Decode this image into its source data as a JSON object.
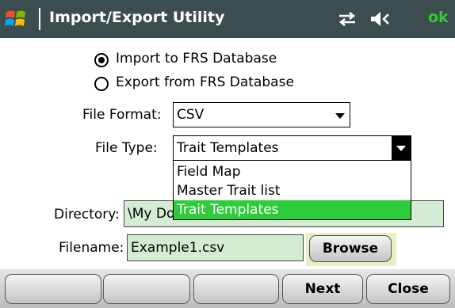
{
  "titlebar": {
    "title": "Import/Export Utility",
    "ok_label": "ok",
    "icons": [
      "windows-start-icon",
      "connectivity-icon",
      "volume-icon"
    ]
  },
  "mode": {
    "import_label": "Import to FRS Database",
    "export_label": "Export from FRS Database",
    "selected": "import"
  },
  "file_format": {
    "label": "File Format:",
    "value": "CSV"
  },
  "file_type": {
    "label": "File Type:",
    "value": "Trait Templates",
    "options": [
      "Field Map",
      "Master Trait list",
      "Trait Templates"
    ],
    "highlighted": "Trait Templates"
  },
  "directory": {
    "label": "Directory:",
    "value_visible": "\\My Do"
  },
  "filename": {
    "label": "Filename:",
    "value": "Example1.csv",
    "browse_label": "Browse"
  },
  "softkeys": [
    "",
    "",
    "",
    "Next",
    "Close"
  ],
  "colors": {
    "titlebar": "#3b4d4f",
    "field_bg": "#d4ecd4",
    "highlight": "#2ecc3a",
    "ok": "#33cc33"
  }
}
